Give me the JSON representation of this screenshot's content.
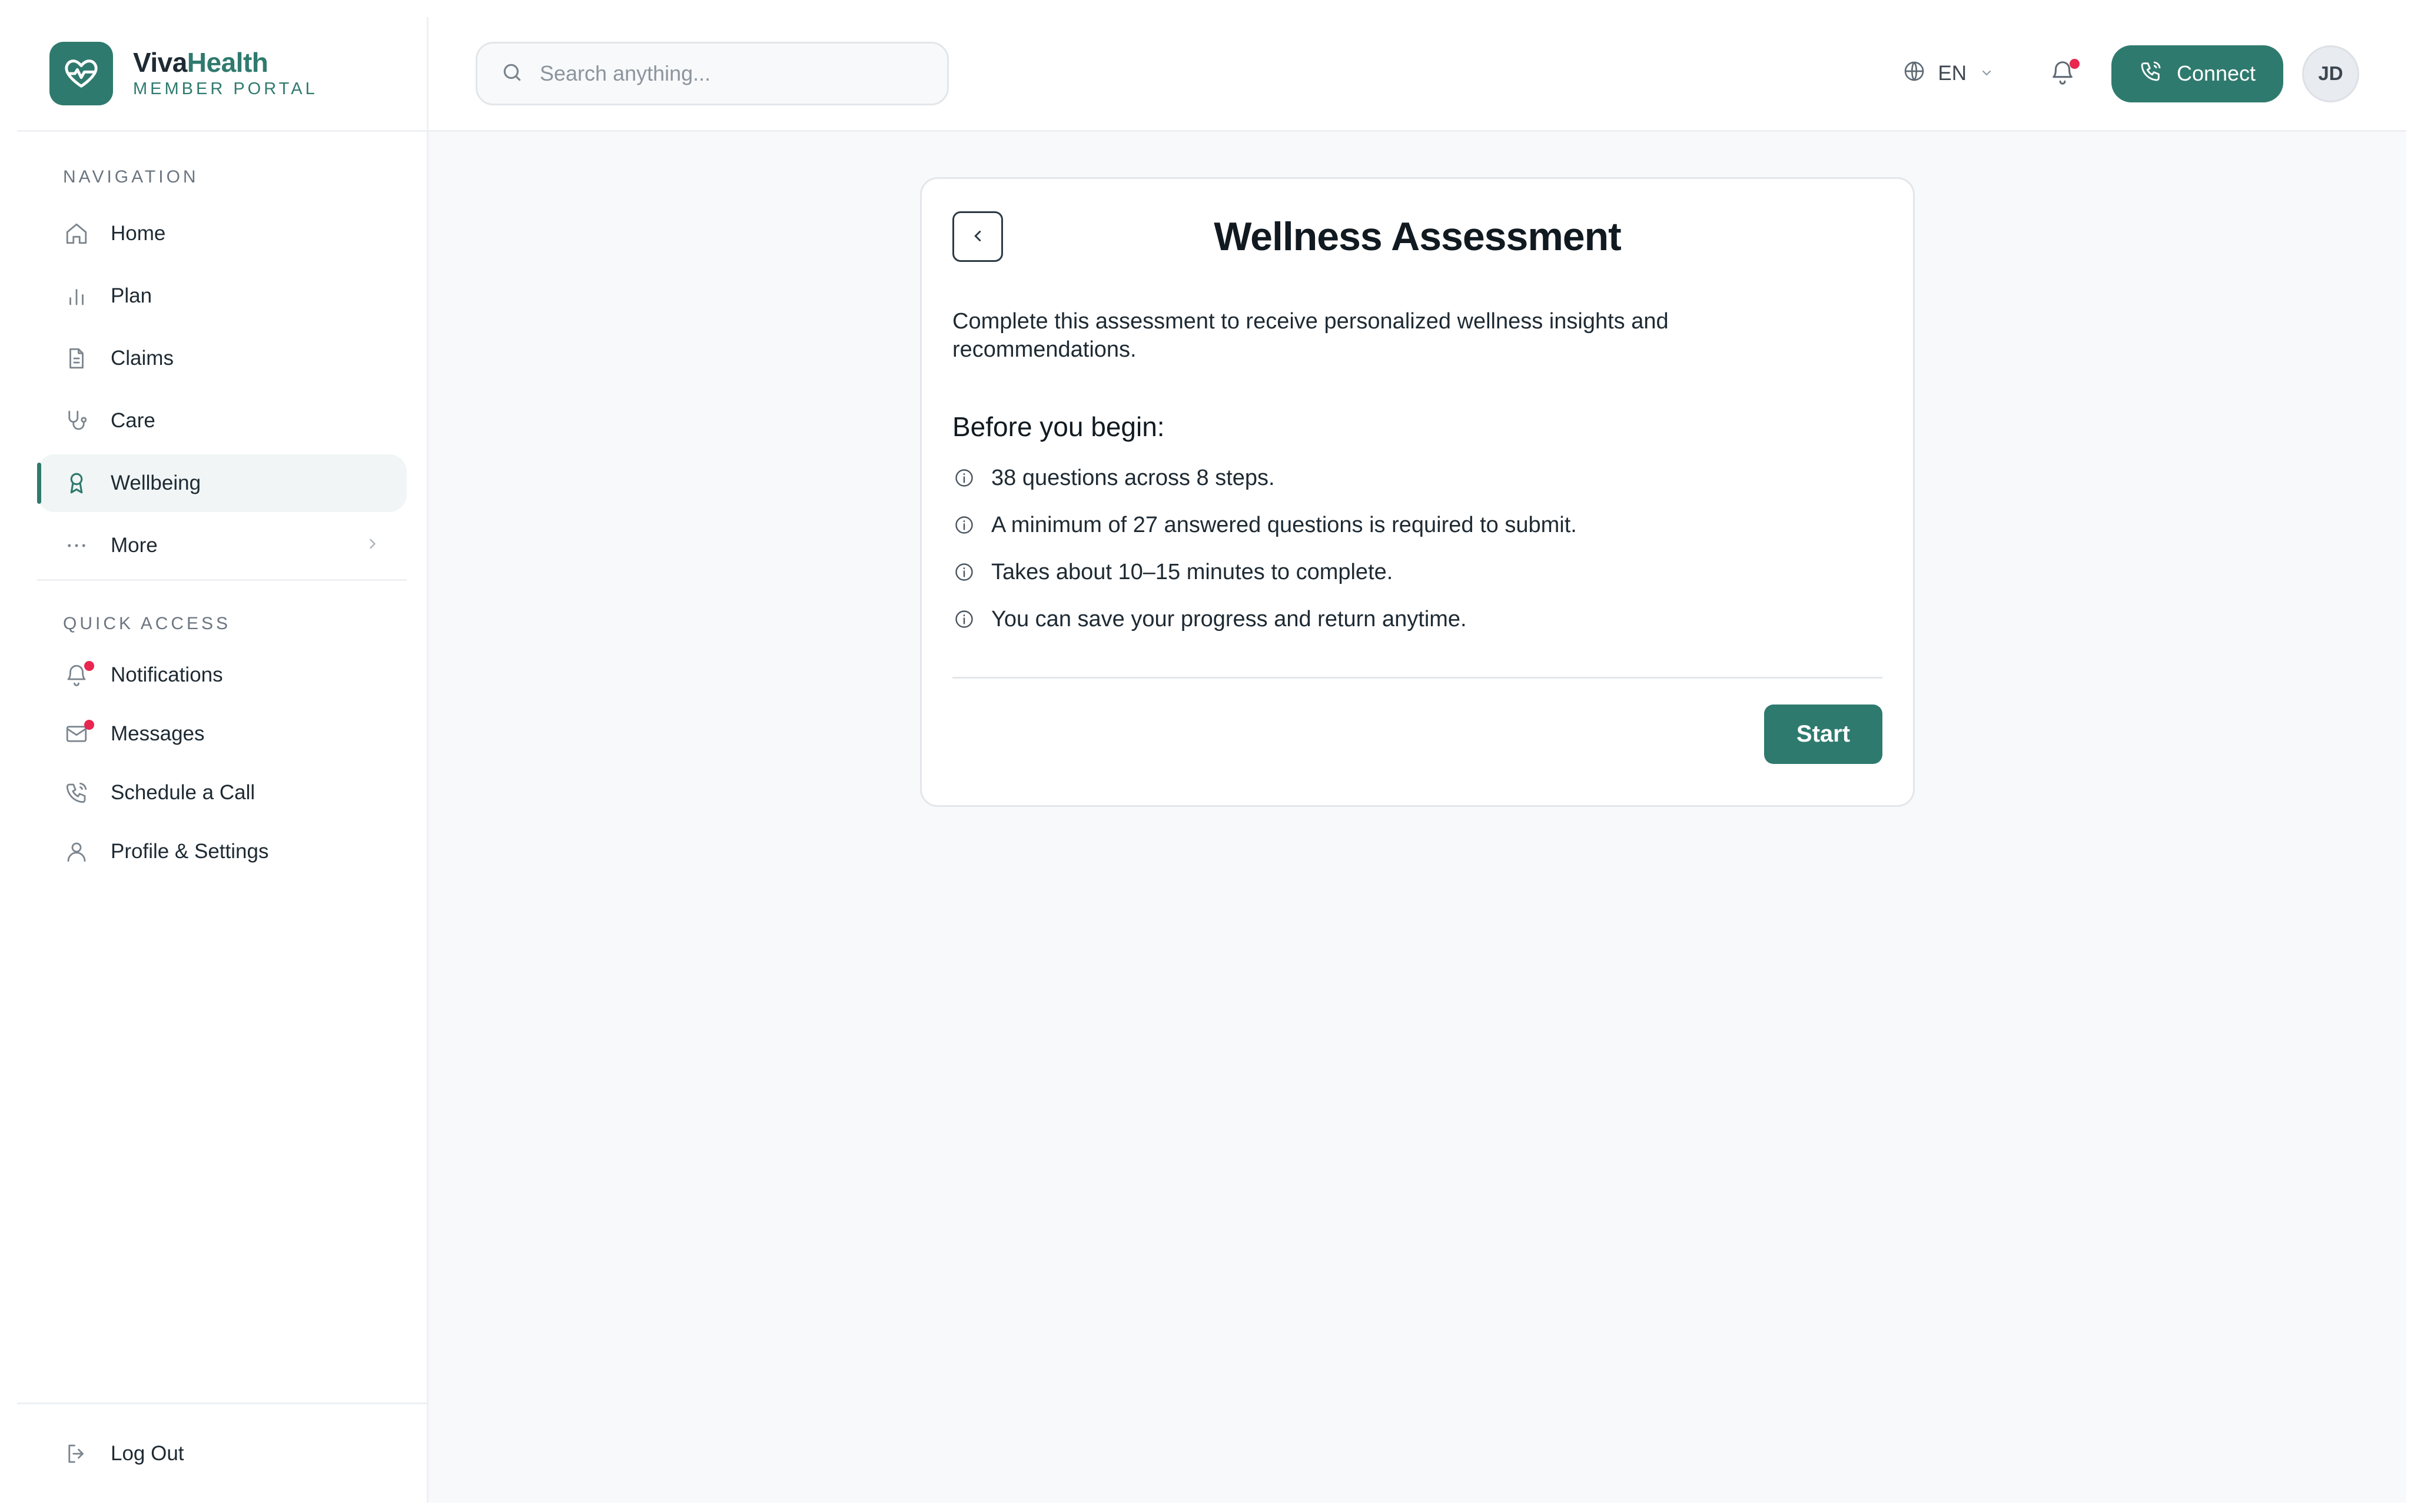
{
  "brand": {
    "name_part1": "Viva",
    "name_part2": "Health",
    "subtitle": "MEMBER PORTAL",
    "logo_icon": "heart-pulse-icon"
  },
  "sidebar": {
    "nav_label": "NAVIGATION",
    "nav_items": [
      {
        "label": "Home",
        "icon": "home-icon"
      },
      {
        "label": "Plan",
        "icon": "bar-chart-icon"
      },
      {
        "label": "Claims",
        "icon": "document-icon"
      },
      {
        "label": "Care",
        "icon": "stethoscope-icon"
      },
      {
        "label": "Wellbeing",
        "icon": "award-icon",
        "active": true
      },
      {
        "label": "More",
        "icon": "ellipsis-icon"
      }
    ],
    "quick_label": "QUICK ACCESS",
    "quick_items": [
      {
        "label": "Notifications",
        "icon": "bell-icon",
        "badge": true
      },
      {
        "label": "Messages",
        "icon": "mail-icon",
        "badge": true
      },
      {
        "label": "Schedule a Call",
        "icon": "phone-icon"
      },
      {
        "label": "Profile & Settings",
        "icon": "user-icon"
      }
    ],
    "logout_label": "Log Out"
  },
  "topbar": {
    "search_placeholder": "Search anything...",
    "language": "EN",
    "connect_label": "Connect",
    "avatar_initials": "JD"
  },
  "card": {
    "title": "Wellness Assessment",
    "intro": "Complete this assessment to receive personalized wellness insights and recommendations.",
    "before_heading": "Before you begin:",
    "items": [
      "38 questions across 8 steps.",
      "A minimum of 27 answered questions is required to submit.",
      "Takes about 10–15 minutes to complete.",
      "You can save your progress and return anytime."
    ],
    "start_label": "Start"
  },
  "colors": {
    "accent": "#2f7a6e",
    "badge": "#e8264f",
    "background": "#f8f9fb"
  }
}
